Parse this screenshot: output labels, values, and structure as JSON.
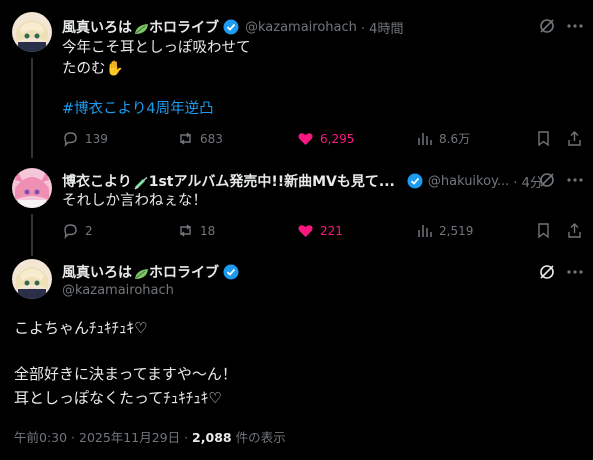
{
  "colors": {
    "background": "#000000",
    "text": "#e7e9ea",
    "muted": "#71767b",
    "accent": "#1d9bf0",
    "like": "#f91880"
  },
  "post1": {
    "author": "風真いろは",
    "author_suffix": "ホロライブ",
    "handle": "@kazamairohach",
    "time": "· 4時間",
    "line1": "今年こそ耳としっぽ吸わせて",
    "line2": "たのむ✋",
    "hashtag": "#博衣こより4周年逆凸",
    "replies": "139",
    "reposts": "683",
    "likes": "6,295",
    "views": "8.6万"
  },
  "post2": {
    "author": "博衣こより",
    "author_suffix": "1stアルバム発売中!!新曲MVも見て...",
    "handle": "@hakuikoy...",
    "time": "· 4分",
    "line1": "それしか言わねぇな！",
    "replies": "2",
    "reposts": "18",
    "likes": "221",
    "views": "2,519"
  },
  "post3": {
    "author": "風真いろは",
    "author_suffix": "ホロライブ",
    "handle": "@kazamairohach",
    "line1": "こよちゃんﾁｭｷﾁｭｷ♡",
    "line2": "全部好きに決まってますや〜ん！",
    "line3": "耳としっぽなくたってﾁｭｷﾁｭｷ♡",
    "timestamp": "午前0:30 · 2025年11月29日 ·",
    "view_count": "2,088",
    "view_label": "件の表示"
  },
  "icons": [
    "grok-icon",
    "more-icon",
    "reply-icon",
    "repost-icon",
    "like-icon",
    "views-icon",
    "bookmark-icon",
    "share-icon",
    "verified-icon",
    "leaf-icon",
    "syringe-icon"
  ]
}
